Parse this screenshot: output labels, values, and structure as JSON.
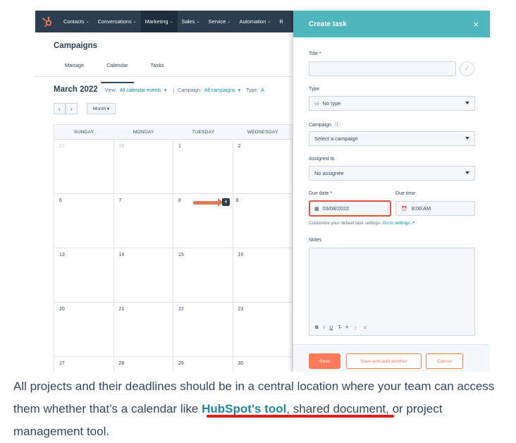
{
  "nav": {
    "items": [
      "Contacts",
      "Conversations",
      "Marketing",
      "Sales",
      "Service",
      "Automation",
      "R"
    ],
    "active": "Marketing"
  },
  "page": {
    "title": "Campaigns",
    "tabs": [
      "Manage",
      "Calendar",
      "Tasks"
    ],
    "active_tab": "Calendar"
  },
  "calendar": {
    "month": "March 2022",
    "view_label": "View:",
    "view_value": "All calendar events",
    "campaign_label": "Campaign:",
    "campaign_value": "All campaigns",
    "type_label": "Type:",
    "type_value": "A",
    "prev": "‹",
    "next": "›",
    "month_button": "Month",
    "weekdays": [
      "SUNDAY",
      "MONDAY",
      "TUESDAY",
      "WEDNESDAY"
    ],
    "weeks": [
      [
        "27",
        "28",
        "1",
        "2"
      ],
      [
        "6",
        "7",
        "8",
        "9"
      ],
      [
        "13",
        "14",
        "15",
        "16"
      ],
      [
        "20",
        "21",
        "22",
        "23"
      ],
      [
        "27",
        "28",
        "29",
        "30"
      ]
    ],
    "add_button": "+"
  },
  "panel": {
    "title": "Create task",
    "close": "×",
    "title_label": "Title *",
    "title_value": "",
    "type_label": "Type",
    "type_value": "No type",
    "campaign_label": "Campaign",
    "campaign_placeholder": "Select a campaign",
    "assigned_label": "Assigned to",
    "assigned_value": "No assignee",
    "due_date_label": "Due date *",
    "due_date": "03/08/2022",
    "due_time_label": "Due time",
    "due_time": "8:00 AM",
    "hint": "Customize your default task settings.",
    "hint_link": "Go to settings",
    "notes_label": "Notes",
    "toolbar": [
      "B",
      "I",
      "U",
      "T̶",
      "≡",
      "⋮",
      "☺"
    ],
    "save": "Save",
    "save_another": "Save and add another",
    "cancel": "Cancel"
  },
  "caption": {
    "before": "All projects and their deadlines should be in a central location where your team can access them whether that’s a calendar like ",
    "highlight": "HubSpot's tool",
    "after": ", shared document, or project management tool."
  },
  "colors": {
    "nav_bg": "#2d3e50",
    "panel_header": "#4fb6bd",
    "accent": "#ff7a59",
    "link": "#0091ae",
    "highlight_box": "#d9573f",
    "caption_underline": "#e01e1e"
  }
}
